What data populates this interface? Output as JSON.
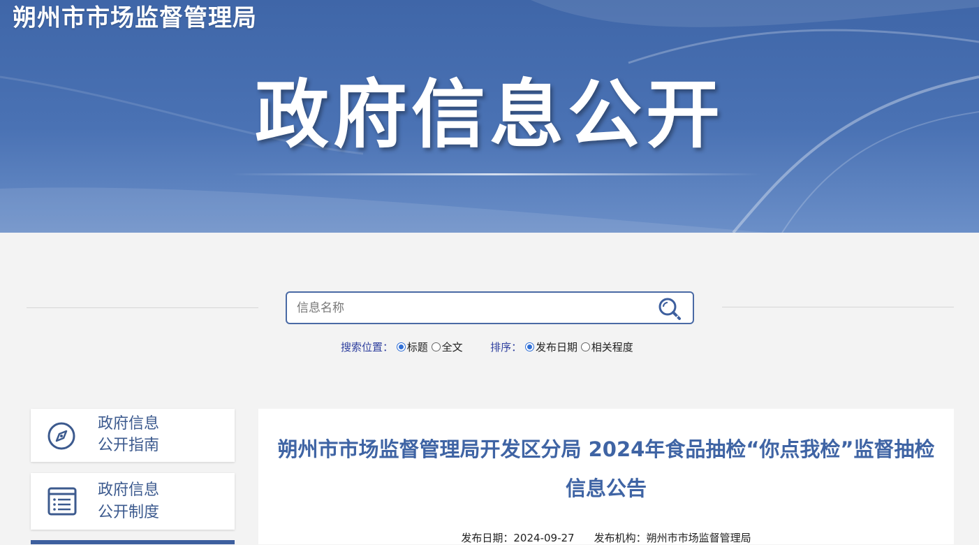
{
  "header": {
    "site_name": "朔州市市场监督管理局",
    "banner_title": "政府信息公开"
  },
  "search": {
    "placeholder": "信息名称",
    "position_label": "搜索位置：",
    "position_options": [
      {
        "label": "标题",
        "checked": true
      },
      {
        "label": "全文",
        "checked": false
      }
    ],
    "sort_label": "排序：",
    "sort_options": [
      {
        "label": "发布日期",
        "checked": true
      },
      {
        "label": "相关程度",
        "checked": false
      }
    ]
  },
  "sidebar": {
    "items": [
      {
        "line1": "政府信息",
        "line2": "公开指南",
        "icon": "compass-icon"
      },
      {
        "line1": "政府信息",
        "line2": "公开制度",
        "icon": "list-document-icon"
      }
    ]
  },
  "article": {
    "title": "朔州市市场监督管理局开发区分局 2024年食品抽检“你点我检”监督抽检信息公告",
    "date_label": "发布日期：",
    "date": "2024-09-27",
    "org_label": "发布机构：",
    "org": "朔州市市场监督管理局"
  },
  "colors": {
    "banner": "#4a72b4",
    "accent": "#3f64a4",
    "search_border": "#4a6aa5"
  }
}
